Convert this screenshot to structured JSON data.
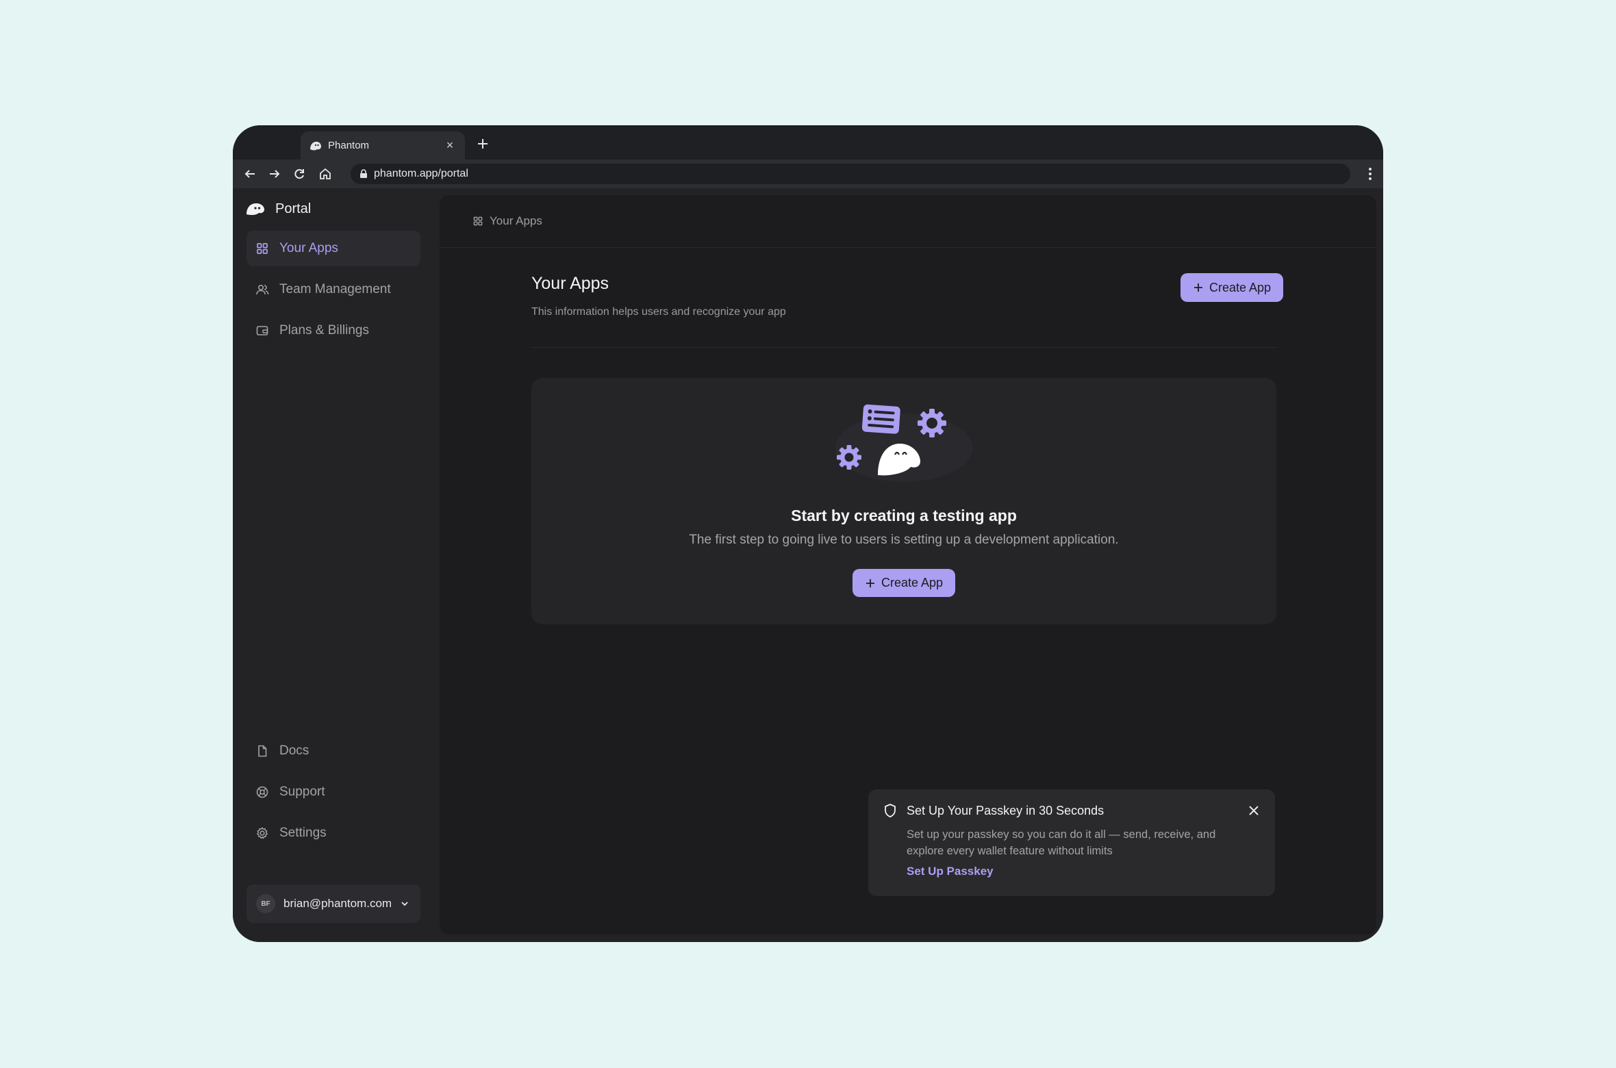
{
  "browser": {
    "tab_title": "Phantom",
    "url": "phantom.app/portal"
  },
  "sidebar": {
    "brand": "Portal",
    "items": [
      {
        "label": "Your Apps",
        "icon": "grid-icon",
        "active": true
      },
      {
        "label": "Team Management",
        "icon": "users-icon",
        "active": false
      },
      {
        "label": "Plans & Billings",
        "icon": "wallet-icon",
        "active": false
      }
    ],
    "bottom_items": [
      {
        "label": "Docs",
        "icon": "file-icon"
      },
      {
        "label": "Support",
        "icon": "lifebuoy-icon"
      },
      {
        "label": "Settings",
        "icon": "gear-icon"
      }
    ],
    "account": {
      "initials": "BF",
      "email": "brian@phantom.com"
    }
  },
  "main": {
    "breadcrumb": "Your Apps",
    "title": "Your Apps",
    "subtitle": "This information helps users and recognize your app",
    "create_button": "Create App",
    "empty_state": {
      "title": "Start by creating a testing app",
      "description": "The first step to going live to users is setting up a development application.",
      "button": "Create App"
    }
  },
  "toast": {
    "title": "Set Up Your Passkey in 30 Seconds",
    "body": "Set up your passkey so you can do it all — send, receive, and explore every wallet feature without limits",
    "link": "Set Up Passkey"
  },
  "colors": {
    "accent": "#ab9ff2",
    "background": "#e5f5f3",
    "panel": "#1c1c1e",
    "sidebar": "#232326"
  }
}
